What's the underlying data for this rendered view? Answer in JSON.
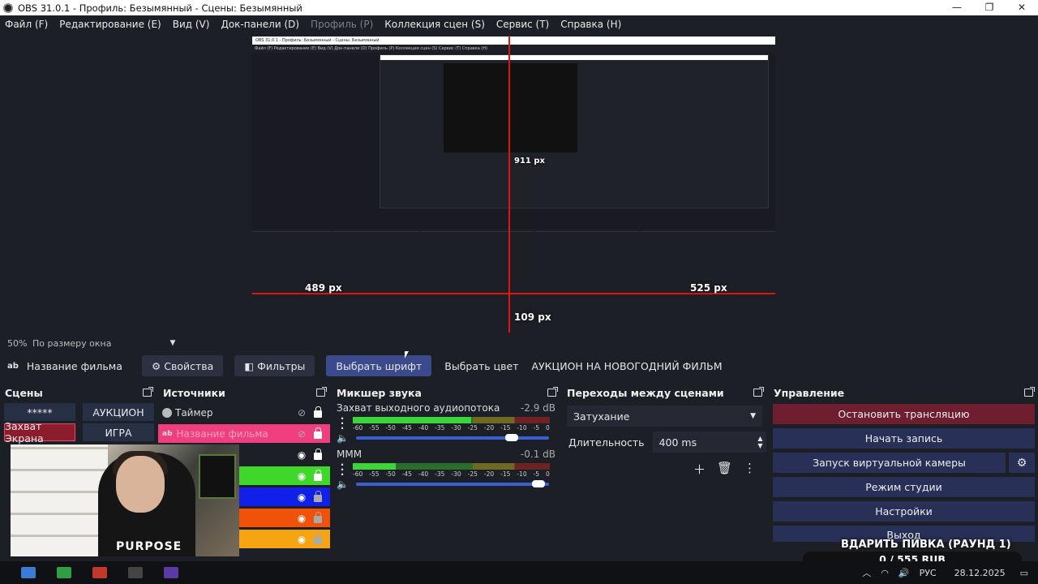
{
  "window": {
    "title": "OBS 31.0.1 - Профиль: Безымянный - Сцены: Безымянный",
    "controls": {
      "minimize": "—",
      "maximize": "❐",
      "close": "✕"
    }
  },
  "menu": {
    "items": [
      {
        "label": "Файл (F)",
        "enabled": true
      },
      {
        "label": "Редактирование (E)",
        "enabled": true
      },
      {
        "label": "Вид (V)",
        "enabled": true
      },
      {
        "label": "Док-панели (D)",
        "enabled": true
      },
      {
        "label": "Профиль (P)",
        "enabled": false
      },
      {
        "label": "Коллекция сцен (S)",
        "enabled": true
      },
      {
        "label": "Сервис (T)",
        "enabled": true
      },
      {
        "label": "Справка (H)",
        "enabled": true
      }
    ]
  },
  "preview": {
    "nested_title": "OBS 31.0.1 - Профиль: Безымянный - Сцены: Безымянный",
    "nested_menu": "Файл (F)   Редактирование (E)   Вид (V)   Док-панели (D)   Профиль (P)   Коллекция сцен (S)   Сервис (T)   Справка (H)",
    "measure_labels": {
      "a": "911 px",
      "b": "489 px",
      "c": "525 px",
      "d": "109 px"
    },
    "accent": "#e01414"
  },
  "status": {
    "zoom": "50%",
    "fit": "По размеру окна",
    "arrow": "▼"
  },
  "context": {
    "source_icon": "ab",
    "source_name": "Название фильма",
    "properties": "Свойства",
    "filters": "Фильтры",
    "choose_font": "Выбрать шрифт",
    "choose_color": "Выбрать цвет",
    "text_value": "АУКЦИОН НА НОВОГОДНИЙ ФИЛЬМ"
  },
  "scenes": {
    "title": "Сцены",
    "items": [
      {
        "label": "*****",
        "active": false
      },
      {
        "label": "АУКЦИОН",
        "active": false
      },
      {
        "label": "Захват Экрана",
        "active": true
      },
      {
        "label": "ИГРА",
        "active": false
      }
    ]
  },
  "sources": {
    "title": "Источники",
    "items": [
      {
        "label": "Таймер",
        "color": "#1d1f26",
        "visible": false
      },
      {
        "label": "Название фильма",
        "color": "#ef3f7f",
        "visible": false
      },
      {
        "label": "",
        "color": "#1d1f26",
        "visible": true
      },
      {
        "label": "",
        "color": "#3fd82a",
        "visible": true
      },
      {
        "label": "",
        "color": "#1020e8",
        "visible": true
      },
      {
        "label": "",
        "color": "#f0520a",
        "visible": true
      },
      {
        "label": "",
        "color": "#f7a412",
        "visible": true
      }
    ]
  },
  "webcam": {
    "shirt_text": "PURPOSE"
  },
  "mixer": {
    "title": "Микшер звука",
    "tracks": [
      {
        "name": "Захват выходного аудиопотока",
        "db": "-2.9 dB",
        "level": 0.6,
        "volume": 0.84
      },
      {
        "name": "МММ",
        "db": "-0.1 dB",
        "level": 0.22,
        "volume": 0.98
      }
    ],
    "scale": [
      "-60",
      "-55",
      "-50",
      "-45",
      "-40",
      "-35",
      "-30",
      "-25",
      "-20",
      "-15",
      "-10",
      "-5",
      "0"
    ]
  },
  "transitions": {
    "title": "Переходы между сценами",
    "selected": "Затухание",
    "duration_label": "Длительность",
    "duration_value": "400 ms"
  },
  "controls": {
    "title": "Управление",
    "stop_stream": "Остановить трансляцию",
    "start_record": "Начать запись",
    "virtual_cam": "Запуск виртуальной камеры",
    "studio_mode": "Режим студии",
    "settings": "Настройки",
    "exit": "Выход"
  },
  "overlay": {
    "headline": "ВДАРИТЬ ПИВКА (РАУНД 1)",
    "amount": "0 / 555 RUB"
  },
  "taskbar": {
    "lang": "РУС",
    "date": "28.12.2025"
  }
}
